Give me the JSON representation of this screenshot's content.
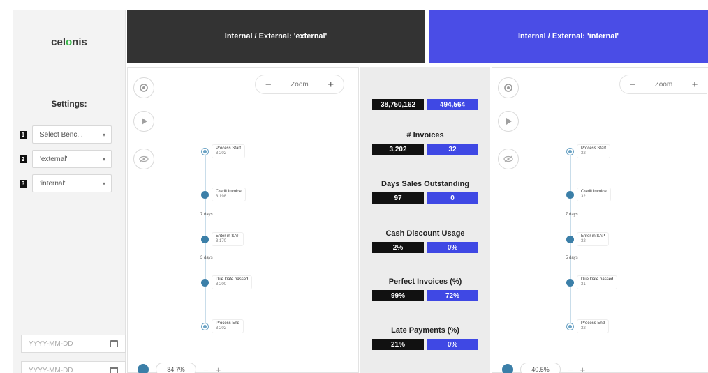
{
  "app": {
    "logo_prefix": "cel",
    "logo_o": "o",
    "logo_suffix": "nis"
  },
  "sidebar": {
    "settings_title": "Settings:",
    "settings": [
      {
        "number": "1",
        "value": "Select Benc...",
        "caret": "▾"
      },
      {
        "number": "2",
        "value": "'external'",
        "caret": "▾"
      },
      {
        "number": "3",
        "value": "'internal'",
        "caret": "▾"
      }
    ],
    "date_inputs": [
      {
        "placeholder": "YYYY-MM-DD"
      },
      {
        "placeholder": "YYYY-MM-DD"
      }
    ]
  },
  "banners": {
    "external": "Internal / External: 'external'",
    "internal": "Internal / External: 'internal'"
  },
  "zoom": {
    "label": "Zoom",
    "minus": "−",
    "plus": "+"
  },
  "process_left": {
    "nodes": [
      {
        "name": "Process Start",
        "count": "3,202",
        "type": "start"
      },
      {
        "name": "Credit Invoice",
        "count": "3,198",
        "type": "activity"
      },
      {
        "name": "Enter in SAP",
        "count": "3,170",
        "type": "activity"
      },
      {
        "name": "Due Date passed",
        "count": "3,200",
        "type": "activity"
      },
      {
        "name": "Process End",
        "count": "3,202",
        "type": "end"
      }
    ],
    "edges": [
      "7 days",
      "3 days"
    ],
    "bottom_value": "84.7%"
  },
  "process_right": {
    "nodes": [
      {
        "name": "Process Start",
        "count": "32",
        "type": "start"
      },
      {
        "name": "Credit Invoice",
        "count": "32",
        "type": "activity"
      },
      {
        "name": "Enter in SAP",
        "count": "32",
        "type": "activity"
      },
      {
        "name": "Due Date passed",
        "count": "31",
        "type": "activity"
      },
      {
        "name": "Process End",
        "count": "32",
        "type": "end"
      }
    ],
    "edges": [
      "7 days",
      "5 days"
    ],
    "bottom_value": "40.5%"
  },
  "kpis": {
    "total": {
      "external": "38,750,162",
      "internal": "494,564"
    },
    "items": [
      {
        "title": "# Invoices",
        "external": "3,202",
        "internal": "32"
      },
      {
        "title": "Days Sales Outstanding",
        "external": "97",
        "internal": "0"
      },
      {
        "title": "Cash Discount Usage",
        "external": "2%",
        "internal": "0%"
      },
      {
        "title": "Perfect Invoices (%)",
        "external": "99%",
        "internal": "72%"
      },
      {
        "title": "Late Payments (%)",
        "external": "21%",
        "internal": "0%"
      }
    ]
  },
  "colors": {
    "external_dark": "#333333",
    "internal_blue": "#4a4de6",
    "logo_accent": "#39b54a",
    "node": "#3b7fa8"
  },
  "icons": {
    "reset": "reset-icon",
    "play": "play-icon",
    "eye": "eye-icon",
    "calendar": "calendar-icon"
  }
}
